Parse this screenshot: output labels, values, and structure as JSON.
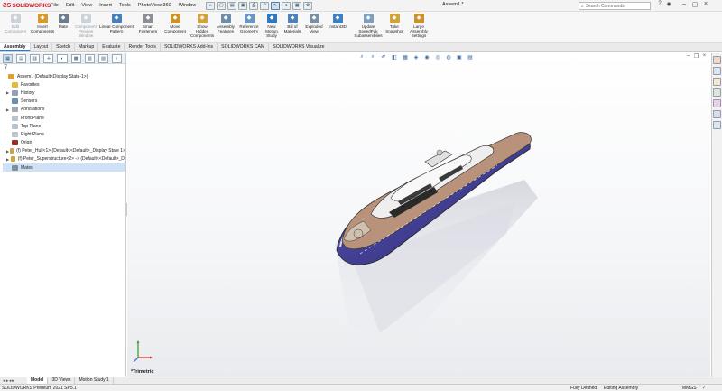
{
  "app": {
    "logo_text": "SOLIDWORKS",
    "document_title": "Assem1 *",
    "search_placeholder": "Search Commands"
  },
  "menu": [
    "File",
    "Edit",
    "View",
    "Insert",
    "Tools",
    "PhotoView 360",
    "Window"
  ],
  "ribbon": [
    {
      "label": "Edit Component",
      "icon": "edit-component-icon",
      "color": "#9aa7b4",
      "enabled": false
    },
    {
      "label": "Insert Components",
      "icon": "insert-components-icon",
      "color": "#d59b2c",
      "enabled": true
    },
    {
      "label": "Mate",
      "icon": "mate-icon",
      "color": "#6d7c8c",
      "enabled": true
    },
    {
      "label": "Component Preview Window",
      "icon": "component-preview-icon",
      "color": "#9aa7b4",
      "enabled": false
    },
    {
      "label": "Linear Component Pattern",
      "icon": "linear-pattern-icon",
      "color": "#4a7fb8",
      "enabled": true
    },
    {
      "label": "Smart Fasteners",
      "icon": "smart-fasteners-icon",
      "color": "#8b8f95",
      "enabled": true
    },
    {
      "label": "Move Component",
      "icon": "move-component-icon",
      "color": "#c9932a",
      "enabled": true
    },
    {
      "label": "Show Hidden Components",
      "icon": "show-hidden-icon",
      "color": "#d2a33a",
      "enabled": true
    },
    {
      "label": "Assembly Features",
      "icon": "assembly-features-icon",
      "color": "#6f8da9",
      "enabled": true
    },
    {
      "label": "Reference Geometry",
      "icon": "reference-geometry-icon",
      "color": "#6b95c4",
      "enabled": true
    },
    {
      "label": "New Motion Study",
      "icon": "motion-study-icon",
      "color": "#2f79c0",
      "enabled": true
    },
    {
      "label": "Bill of Materials",
      "icon": "bill-of-materials-icon",
      "color": "#4f81b6",
      "enabled": true
    },
    {
      "label": "Exploded View",
      "icon": "exploded-view-icon",
      "color": "#7d8ea0",
      "enabled": true
    },
    {
      "label": "Instant3D",
      "icon": "instant3d-icon",
      "color": "#3f7fc0",
      "enabled": true
    },
    {
      "label": "Update SpeedPak Subassemblies",
      "icon": "speedpak-icon",
      "color": "#7f9fbe",
      "enabled": true
    },
    {
      "label": "Take Snapshot",
      "icon": "snapshot-icon",
      "color": "#d2a33a",
      "enabled": true
    },
    {
      "label": "Large Assembly Settings",
      "icon": "large-assembly-icon",
      "color": "#c9932a",
      "enabled": true
    }
  ],
  "tabs": [
    "Assembly",
    "Layout",
    "Sketch",
    "Markup",
    "Evaluate",
    "Render Tools",
    "SOLIDWORKS Add-Ins",
    "SOLIDWORKS CAM",
    "SOLIDWORKS Visualize"
  ],
  "tree": [
    {
      "label": "Assem1  (Default<Display State-1>)",
      "icon": "assembly-icon",
      "expander": "",
      "root": true,
      "color": "#d8a13a"
    },
    {
      "label": "Favorites",
      "icon": "favorites-icon",
      "expander": "",
      "color": "#e2b93b"
    },
    {
      "label": "History",
      "icon": "history-icon",
      "expander": "▶",
      "color": "#8fa2b5"
    },
    {
      "label": "Sensors",
      "icon": "sensors-icon",
      "expander": "",
      "color": "#6a8fb0"
    },
    {
      "label": "Annotations",
      "icon": "annotations-icon",
      "expander": "▶",
      "color": "#a0a8b0"
    },
    {
      "label": "Front Plane",
      "icon": "plane-icon",
      "expander": "",
      "color": "#b9c3cc"
    },
    {
      "label": "Top Plane",
      "icon": "plane-icon",
      "expander": "",
      "color": "#b9c3cc"
    },
    {
      "label": "Right Plane",
      "icon": "plane-icon",
      "expander": "",
      "color": "#b9c3cc"
    },
    {
      "label": "Origin",
      "icon": "origin-icon",
      "expander": "",
      "color": "#9b2c2c"
    },
    {
      "label": "(f) Peter_Hull<1> (Default<<Default>_Display State 1>",
      "icon": "part-icon",
      "expander": "▶",
      "color": "#d2a33a"
    },
    {
      "label": "(f) Peter_Superstructure<2> -> (Default<<Default>_Di",
      "icon": "part-icon",
      "expander": "▶",
      "color": "#d2a33a"
    },
    {
      "label": "Mates",
      "icon": "mates-icon",
      "expander": "",
      "color": "#7f8f9f",
      "selected": true
    }
  ],
  "viewport": {
    "view_label": "*Trimetric"
  },
  "bottom_tabs": [
    "Model",
    "3D Views",
    "Motion Study 1"
  ],
  "status": {
    "product": "SOLIDWORKS Premium 2021 SP5.1",
    "defined": "Fully Defined",
    "mode": "Editing Assembly",
    "units": "MMGS"
  },
  "colors": {
    "accent": "#3a78c2",
    "hull_blue": "#3e3b8f",
    "deck_wood": "#b8927a"
  }
}
